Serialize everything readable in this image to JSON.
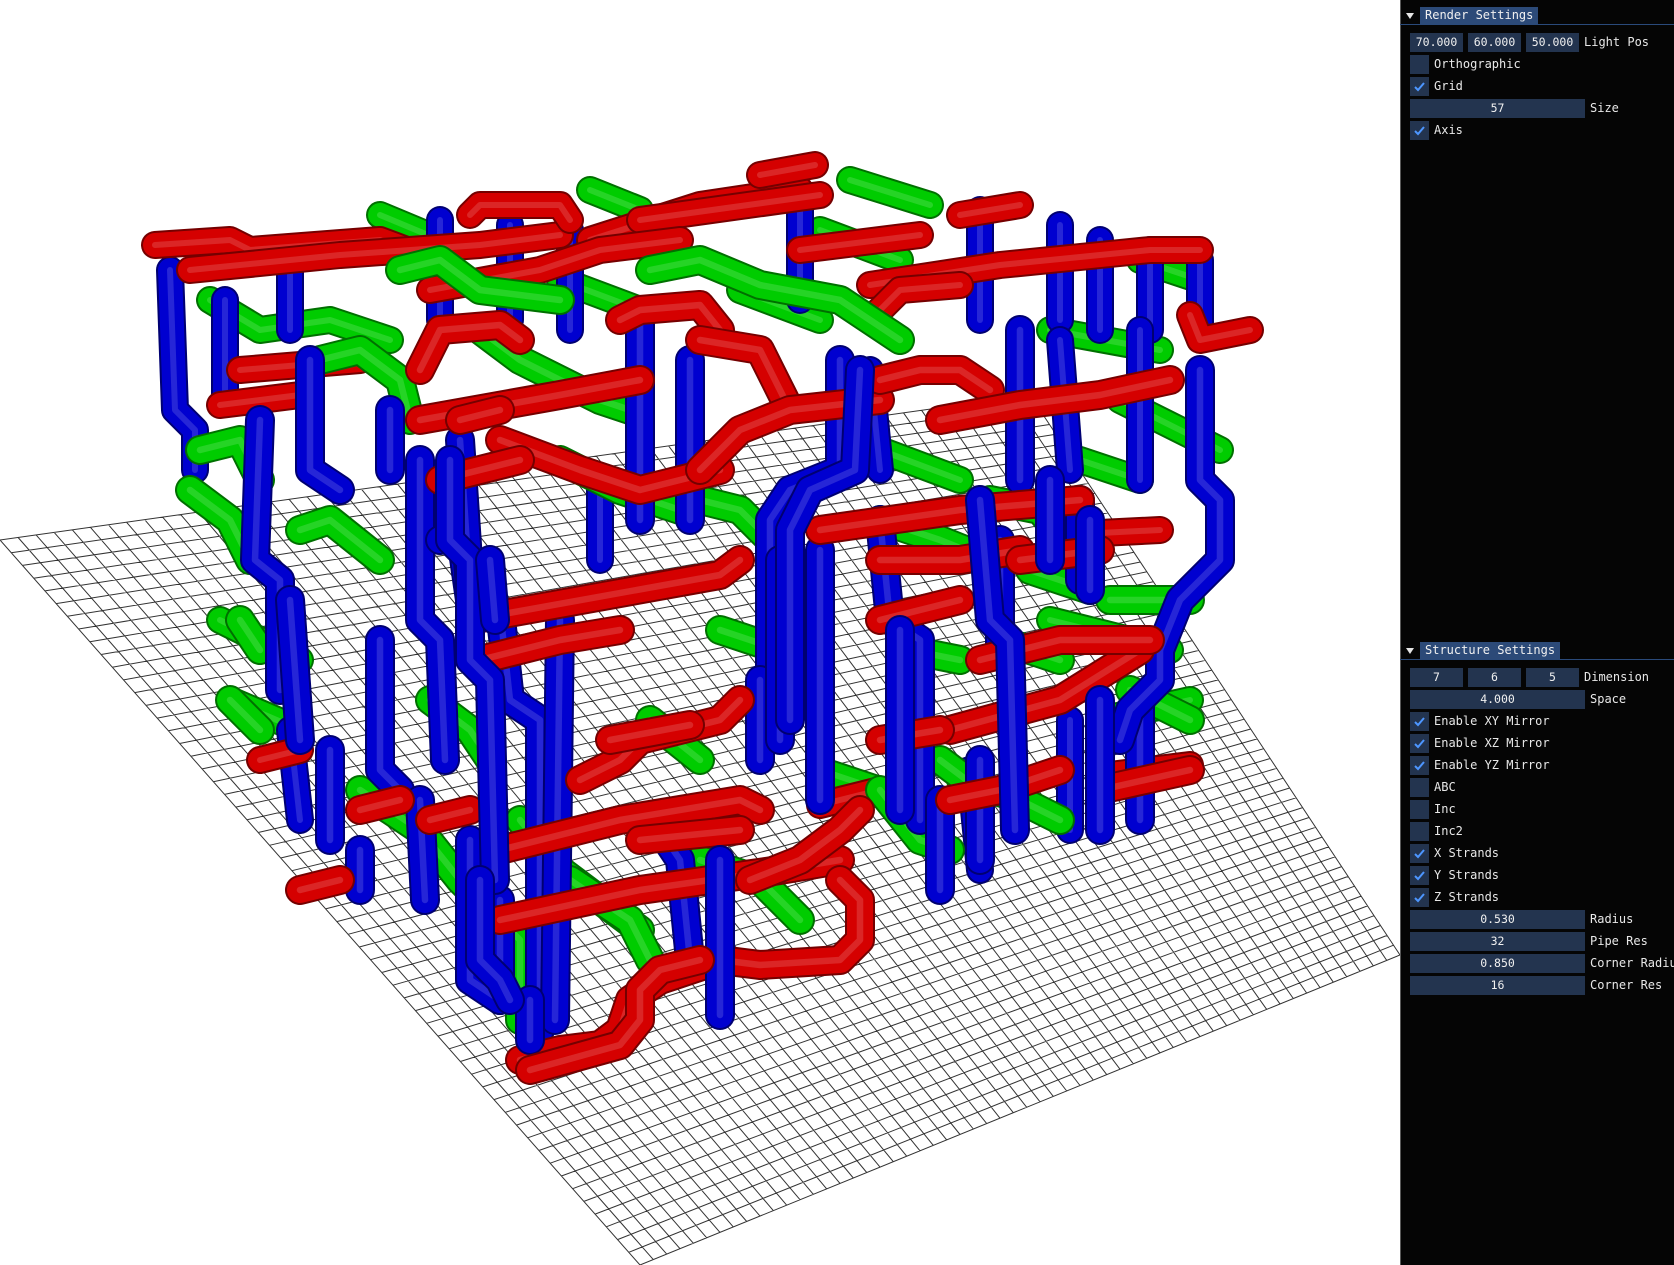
{
  "render_settings": {
    "title": "Render Settings",
    "light_pos": {
      "x": "70.000",
      "y": "60.000",
      "z": "50.000",
      "label": "Light Pos"
    },
    "orthographic": {
      "label": "Orthographic",
      "checked": false
    },
    "grid": {
      "label": "Grid",
      "checked": true
    },
    "size": {
      "value": "57",
      "label": "Size"
    },
    "axis": {
      "label": "Axis",
      "checked": true
    }
  },
  "structure_settings": {
    "title": "Structure Settings",
    "dimension": {
      "x": "7",
      "y": "6",
      "z": "5",
      "label": "Dimension"
    },
    "space": {
      "value": "4.000",
      "label": "Space"
    },
    "enable_xy_mirror": {
      "label": "Enable XY Mirror",
      "checked": true
    },
    "enable_xz_mirror": {
      "label": "Enable XZ Mirror",
      "checked": true
    },
    "enable_yz_mirror": {
      "label": "Enable YZ Mirror",
      "checked": true
    },
    "abc": {
      "label": "ABC",
      "checked": false
    },
    "inc": {
      "label": "Inc",
      "checked": false
    },
    "inc2": {
      "label": "Inc2",
      "checked": false
    },
    "x_strands": {
      "label": "X Strands",
      "checked": true
    },
    "y_strands": {
      "label": "Y Strands",
      "checked": true
    },
    "z_strands": {
      "label": "Z Strands",
      "checked": true
    },
    "radius": {
      "value": "0.530",
      "label": "Radius"
    },
    "pipe_res": {
      "value": "32",
      "label": "Pipe Res"
    },
    "corner_radius": {
      "value": "0.850",
      "label": "Corner Radius"
    },
    "corner_res": {
      "value": "16",
      "label": "Corner Res"
    }
  },
  "colors": {
    "x_strand": "#d50000",
    "y_strand": "#0000d0",
    "z_strand": "#00cc00",
    "panel_bg": "#050505",
    "field_bg": "#23344f",
    "title_tab": "#2c4a78",
    "check_mark": "#4d96ff"
  }
}
